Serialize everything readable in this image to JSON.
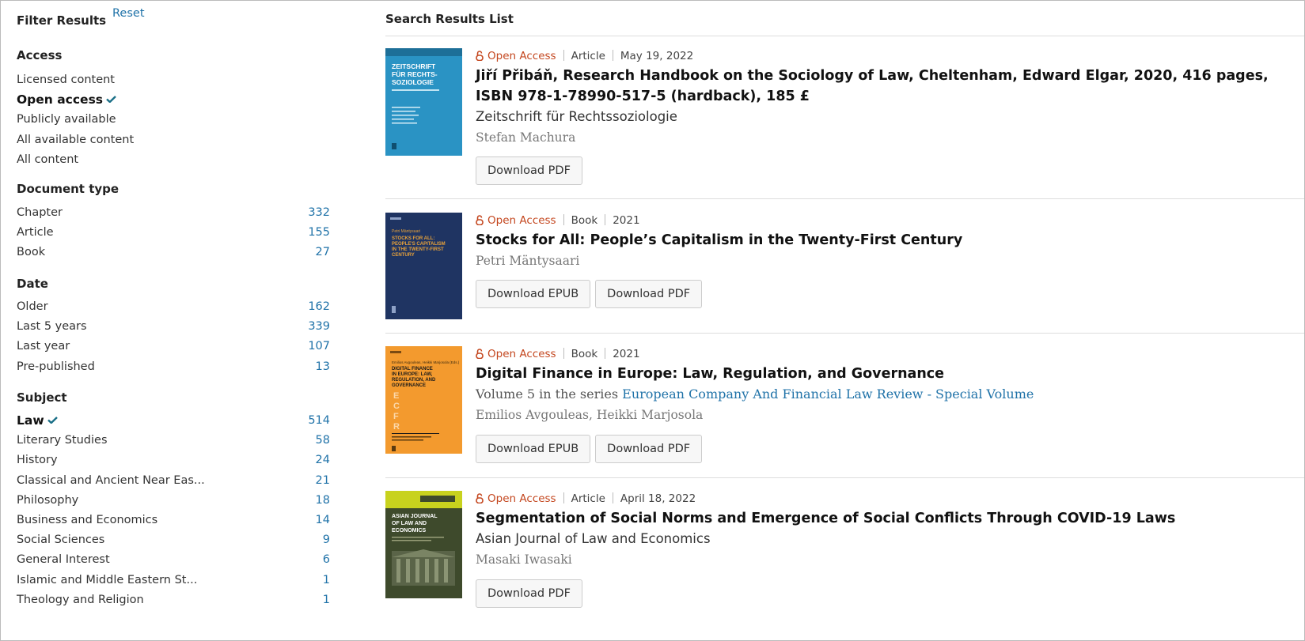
{
  "filters": {
    "title": "Filter Results",
    "reset_label": "Reset",
    "access": {
      "title": "Access",
      "items": [
        {
          "label": "Licensed content",
          "selected": false
        },
        {
          "label": "Open access",
          "selected": true
        },
        {
          "label": "Publicly available",
          "selected": false
        },
        {
          "label": "All available content",
          "selected": false
        },
        {
          "label": "All content",
          "selected": false
        }
      ]
    },
    "document_type": {
      "title": "Document type",
      "items": [
        {
          "label": "Chapter",
          "count": "332"
        },
        {
          "label": "Article",
          "count": "155"
        },
        {
          "label": "Book",
          "count": "27"
        }
      ]
    },
    "date": {
      "title": "Date",
      "items": [
        {
          "label": "Older",
          "count": "162"
        },
        {
          "label": "Last 5 years",
          "count": "339"
        },
        {
          "label": "Last year",
          "count": "107"
        },
        {
          "label": "Pre-published",
          "count": "13"
        }
      ]
    },
    "subject": {
      "title": "Subject",
      "items": [
        {
          "label": "Law",
          "count": "514",
          "selected": true
        },
        {
          "label": "Literary Studies",
          "count": "58"
        },
        {
          "label": "History",
          "count": "24"
        },
        {
          "label": "Classical and Ancient Near Eas...",
          "count": "21"
        },
        {
          "label": "Philosophy",
          "count": "18"
        },
        {
          "label": "Business and Economics",
          "count": "14"
        },
        {
          "label": "Social Sciences",
          "count": "9"
        },
        {
          "label": "General Interest",
          "count": "6"
        },
        {
          "label": "Islamic and Middle Eastern St...",
          "count": "1"
        },
        {
          "label": "Theology and Religion",
          "count": "1"
        }
      ]
    }
  },
  "results": {
    "heading": "Search Results List",
    "items": [
      {
        "access": "Open Access",
        "type": "Article",
        "date": "May 19, 2022",
        "title": "Jiří Přibáň, Research Handbook on the Sociology of Law, Cheltenham, Edward Elgar, 2020, 416 pages, ISBN 978-1-78990-517-5 (hardback), 185 £",
        "journal": "Zeitschrift für Rechtssoziologie",
        "authors": "Stefan Machura",
        "buttons": [
          "Download PDF"
        ],
        "cover": {
          "color": "#2a93c4",
          "text": "ZEITSCHRIFT FÜR RECHTS-SOZIOLOGIE",
          "text_color": "#ffffff"
        }
      },
      {
        "access": "Open Access",
        "type": "Book",
        "date": "2021",
        "title": "Stocks for All: People’s Capitalism in the Twenty-First Century",
        "authors": "Petri Mäntysaari",
        "buttons": [
          "Download EPUB",
          "Download PDF"
        ],
        "cover": {
          "color": "#1f3462",
          "text": "STOCKS FOR ALL: PEOPLE'S CAPITALISM IN THE TWENTY-FIRST CENTURY",
          "text_color": "#e8a23a"
        }
      },
      {
        "access": "Open Access",
        "type": "Book",
        "date": "2021",
        "title": "Digital Finance in Europe: Law, Regulation, and Governance",
        "series_prefix": "Volume 5 in the series",
        "series_link": "European Company And Financial Law Review - Special Volume",
        "authors": "Emilios Avgouleas, Heikki Marjosola",
        "buttons": [
          "Download EPUB",
          "Download PDF"
        ],
        "cover": {
          "color": "#f39a2e",
          "text": "DIGITAL FINANCE IN EUROPE: LAW, REGULATION, AND GOVERNANCE",
          "text_color": "#1a1a1a",
          "letters": "ECFR"
        }
      },
      {
        "access": "Open Access",
        "type": "Article",
        "date": "April 18, 2022",
        "title": "Segmentation of Social Norms and Emergence of Social Conflicts Through COVID-19 Laws",
        "journal": "Asian Journal of Law and Economics",
        "authors": "Masaki Iwasaki",
        "buttons": [
          "Download PDF"
        ],
        "cover": {
          "color": "#3e4a2c",
          "text": "ASIAN JOURNAL OF LAW AND ECONOMICS",
          "text_color": "#ffffff",
          "band": "#c8d21e"
        }
      }
    ]
  },
  "colors": {
    "link": "#1f72a8",
    "open_access": "#c4471f",
    "check": "#1a6f87"
  },
  "icons": {
    "check": "check-icon",
    "open_access": "open-lock-icon"
  }
}
